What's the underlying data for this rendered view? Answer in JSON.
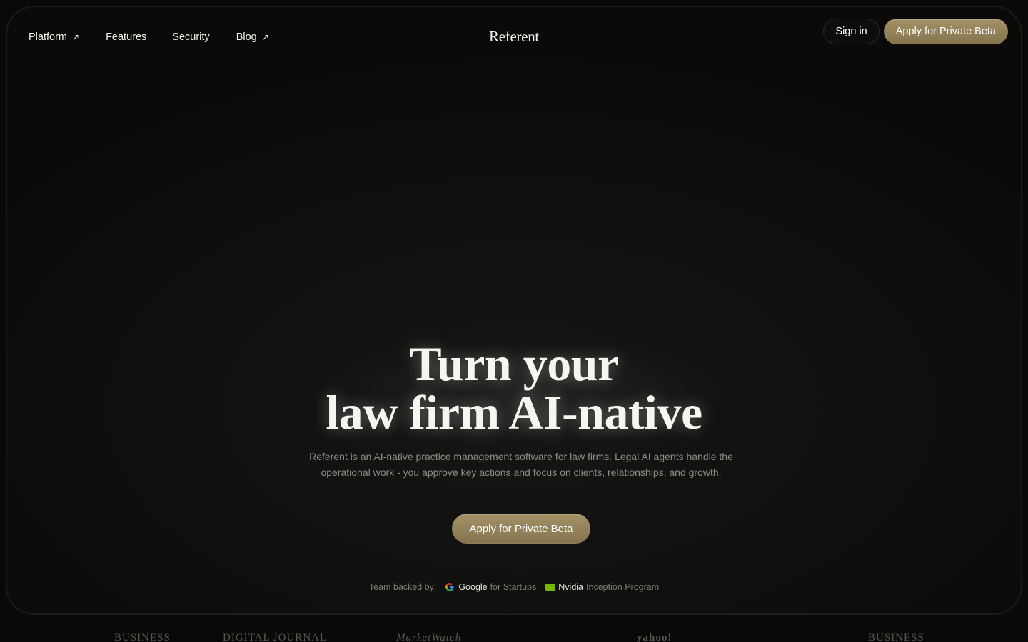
{
  "nav": {
    "links": [
      {
        "label": "Platform",
        "external": true
      },
      {
        "label": "Features",
        "external": false
      },
      {
        "label": "Security",
        "external": false
      },
      {
        "label": "Blog",
        "external": true
      }
    ],
    "brand": "Referent",
    "signin_label": "Sign in",
    "apply_label": "Apply for Private Beta"
  },
  "hero": {
    "title_line1": "Turn your",
    "title_line2": "law firm AI-native",
    "subtitle": "Referent is an AI-native practice management software for law firms. Legal AI agents handle the operational work - you approve key actions and focus on clients, relationships, and growth.",
    "cta_label": "Apply for Private Beta"
  },
  "backing": {
    "label": "Team backed by:",
    "backers": [
      {
        "name": "Google",
        "program": "for Startups",
        "icon": "google-icon"
      },
      {
        "name": "Nvidia",
        "program": "Inception Program",
        "icon": "nvidia-icon"
      }
    ]
  },
  "press": [
    "BUSINESS",
    "DIGITAL JOURNAL",
    "MarketWatch",
    "yahoo!",
    "BUSINESS"
  ],
  "colors": {
    "accent_gold": "#9a8a5f",
    "background": "#0a0908"
  }
}
